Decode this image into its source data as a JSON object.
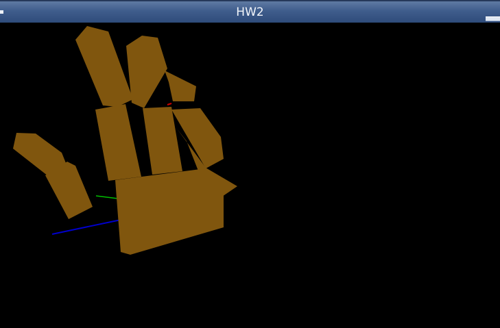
{
  "window": {
    "title": "HW2"
  },
  "colors": {
    "titlebar": "#3f5d8c",
    "background": "#000000",
    "hand": "#80560e",
    "axis_x": "#d00000",
    "axis_y": "#00c000",
    "axis_z": "#0000cc"
  },
  "icons": {
    "system_menu": "small-square-icon",
    "minimize": "minimize-bar-icon"
  }
}
